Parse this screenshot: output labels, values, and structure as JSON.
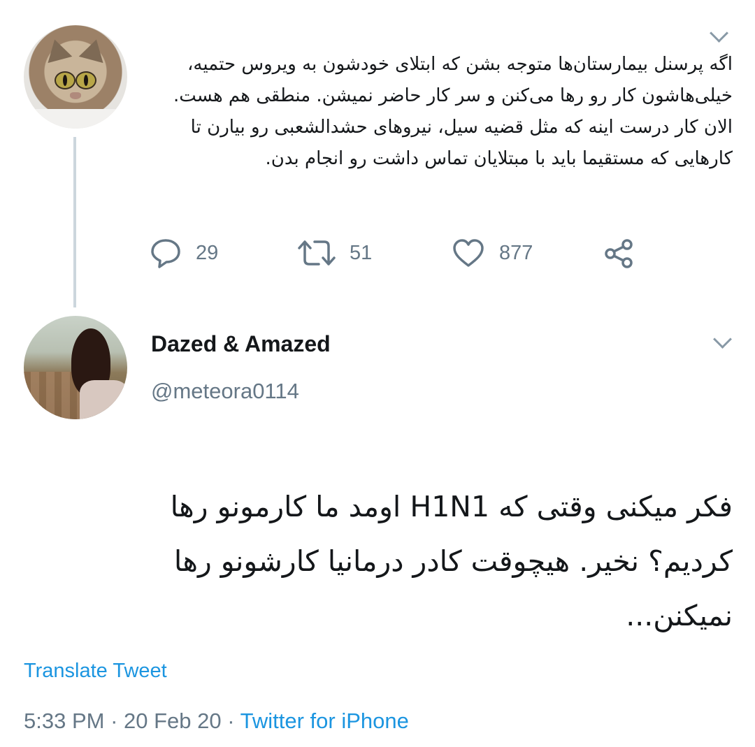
{
  "parent_tweet": {
    "text": "اگه پرسنل بیمارستان‌ها متوجه بشن که ابتلای خودشون به ویروس حتمیه، خیلی‌هاشون کار رو رها می‌کنن و سر کار حاضر نمیشن. منطقی هم هست. الان کار درست اینه که مثل قضیه سیل، نیروهای حشدالشعبی رو بیارن تا کارهایی که مستقیما باید با مبتلایان تماس داشت رو انجام بدن.",
    "replies": "29",
    "retweets": "51",
    "likes": "877"
  },
  "reply_tweet": {
    "display_name": "Dazed & Amazed",
    "handle": "@meteora0114",
    "text": "فکر میکنی وقتی که H1N1 اومد ما کارمونو رها کردیم؟ نخیر. هیچوقت کادر درمانیا کارشونو رها نمیکنن...",
    "translate_label": "Translate Tweet",
    "time": "5:33 PM",
    "separator": "·",
    "date": "20 Feb 20",
    "source": "Twitter for iPhone"
  },
  "icons": {
    "reply": "reply-icon",
    "retweet": "retweet-icon",
    "like": "heart-icon",
    "share": "share-icon",
    "more": "chevron-down-icon"
  },
  "colors": {
    "text": "#14171a",
    "muted": "#657786",
    "link": "#1b95e0",
    "thread_line": "#ccd6dd"
  }
}
